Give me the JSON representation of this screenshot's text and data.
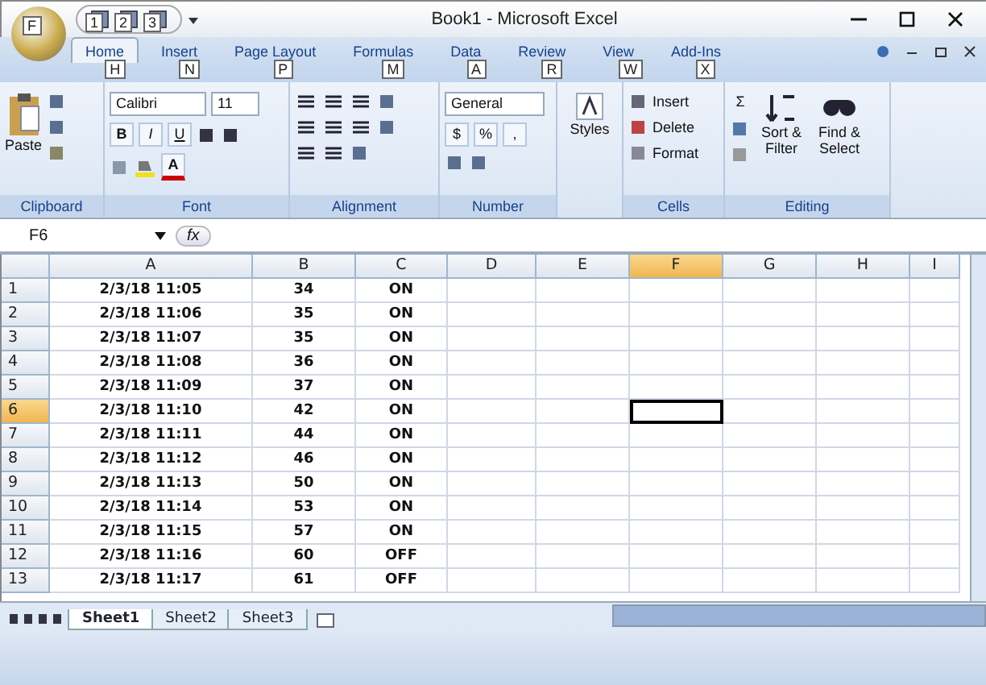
{
  "window": {
    "title": "Book1 - Microsoft Excel",
    "office_keytip": "F"
  },
  "quick_access": [
    {
      "keytip": "1"
    },
    {
      "keytip": "2"
    },
    {
      "keytip": "3"
    }
  ],
  "tabs": [
    {
      "label": "Home",
      "keytip": "H",
      "selected": true
    },
    {
      "label": "Insert",
      "keytip": "N",
      "selected": false
    },
    {
      "label": "Page Layout",
      "keytip": "P",
      "selected": false
    },
    {
      "label": "Formulas",
      "keytip": "M",
      "selected": false
    },
    {
      "label": "Data",
      "keytip": "A",
      "selected": false
    },
    {
      "label": "Review",
      "keytip": "R",
      "selected": false
    },
    {
      "label": "View",
      "keytip": "W",
      "selected": false
    },
    {
      "label": "Add-Ins",
      "keytip": "X",
      "selected": false
    }
  ],
  "ribbon": {
    "clipboard": {
      "paste": "Paste",
      "label": "Clipboard"
    },
    "font": {
      "name": "Calibri",
      "size": "11",
      "bold": "B",
      "italic": "I",
      "underline": "U",
      "font_color": "A",
      "label": "Font"
    },
    "alignment": {
      "label": "Alignment"
    },
    "number": {
      "format": "General",
      "currency": "$",
      "percent": "%",
      "comma": ",",
      "label": "Number"
    },
    "styles": {
      "label": "Styles"
    },
    "cells": {
      "insert": "Insert",
      "delete": "Delete",
      "format": "Format",
      "label": "Cells"
    },
    "editing": {
      "sigma": "Σ",
      "sort": "Sort & Filter",
      "find": "Find & Select",
      "label": "Editing"
    }
  },
  "formula_bar": {
    "name_box": "F6",
    "fx": "fx"
  },
  "sheet": {
    "columns": [
      {
        "label": "A",
        "selected": false
      },
      {
        "label": "B",
        "selected": false
      },
      {
        "label": "C",
        "selected": false
      },
      {
        "label": "D",
        "selected": false
      },
      {
        "label": "E",
        "selected": false
      },
      {
        "label": "F",
        "selected": true
      },
      {
        "label": "G",
        "selected": false
      },
      {
        "label": "H",
        "selected": false
      },
      {
        "label": "I",
        "selected": false
      }
    ],
    "rows": [
      {
        "label": "1",
        "selected": false,
        "cells": [
          "2/3/18 11:05",
          "34",
          "ON"
        ]
      },
      {
        "label": "2",
        "selected": false,
        "cells": [
          "2/3/18 11:06",
          "35",
          "ON"
        ]
      },
      {
        "label": "3",
        "selected": false,
        "cells": [
          "2/3/18 11:07",
          "35",
          "ON"
        ]
      },
      {
        "label": "4",
        "selected": false,
        "cells": [
          "2/3/18 11:08",
          "36",
          "ON"
        ]
      },
      {
        "label": "5",
        "selected": false,
        "cells": [
          "2/3/18 11:09",
          "37",
          "ON"
        ]
      },
      {
        "label": "6",
        "selected": true,
        "cells": [
          "2/3/18 11:10",
          "42",
          "ON"
        ]
      },
      {
        "label": "7",
        "selected": false,
        "cells": [
          "2/3/18 11:11",
          "44",
          "ON"
        ]
      },
      {
        "label": "8",
        "selected": false,
        "cells": [
          "2/3/18 11:12",
          "46",
          "ON"
        ]
      },
      {
        "label": "9",
        "selected": false,
        "cells": [
          "2/3/18 11:13",
          "50",
          "ON"
        ]
      },
      {
        "label": "10",
        "selected": false,
        "cells": [
          "2/3/18 11:14",
          "53",
          "ON"
        ]
      },
      {
        "label": "11",
        "selected": false,
        "cells": [
          "2/3/18 11:15",
          "57",
          "ON"
        ]
      },
      {
        "label": "12",
        "selected": false,
        "cells": [
          "2/3/18 11:16",
          "60",
          "OFF"
        ]
      },
      {
        "label": "13",
        "selected": false,
        "cells": [
          "2/3/18 11:17",
          "61",
          "OFF"
        ]
      }
    ]
  },
  "sheet_tabs": [
    {
      "label": "Sheet1",
      "selected": true
    },
    {
      "label": "Sheet2",
      "selected": false
    },
    {
      "label": "Sheet3",
      "selected": false
    }
  ]
}
